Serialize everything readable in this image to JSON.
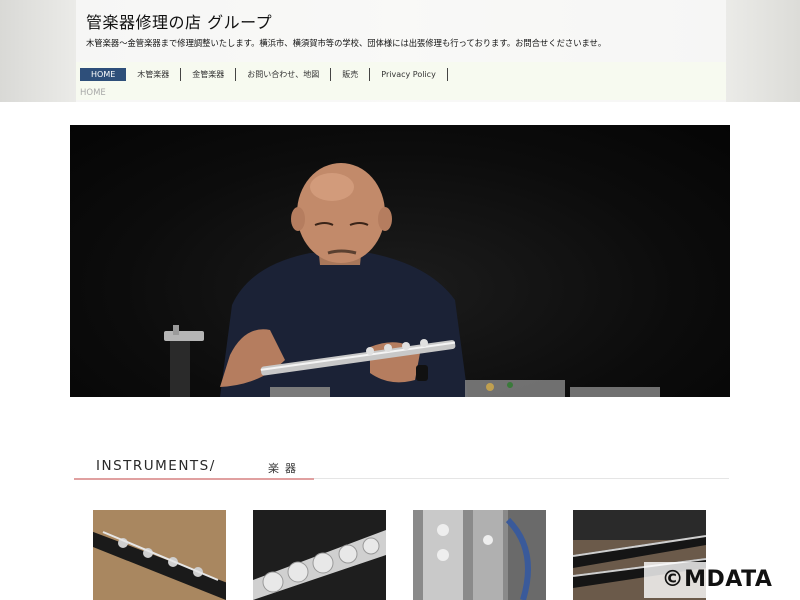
{
  "site": {
    "title": "管楽器修理の店  グループ",
    "tagline": "木管楽器～金管楽器まで修理調整いたします。横浜市、横須賀市等の学校、団体様には出張修理も行っております。お問合せくださいませ。"
  },
  "nav": {
    "items": [
      {
        "label": "HOME",
        "active": true
      },
      {
        "label": "木管楽器"
      },
      {
        "label": "金管楽器"
      },
      {
        "label": "お問い合わせ、地図"
      },
      {
        "label": "販売"
      },
      {
        "label": "Privacy Policy"
      }
    ]
  },
  "breadcrumb": "HOME",
  "section": {
    "title": "INSTRUMENTS/",
    "subtitle": "楽器"
  },
  "colors": {
    "nav_active_bg": "#2e4f7a",
    "accent_underline": "#e0a0a0"
  },
  "watermark": "©MDATA"
}
